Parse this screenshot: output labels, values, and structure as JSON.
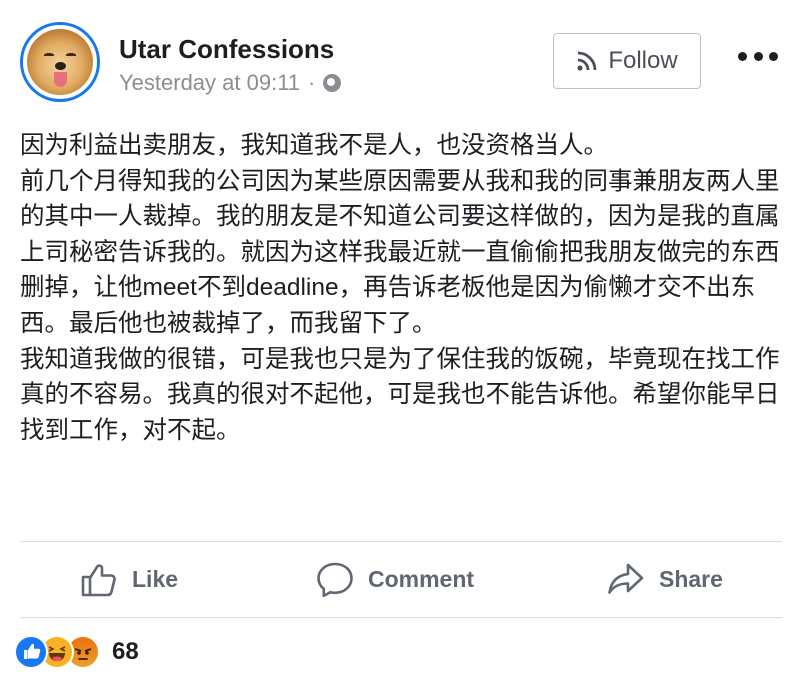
{
  "post": {
    "page_name": "Utar Confessions",
    "timestamp": "Yesterday at 09:11",
    "separator": "·",
    "privacy_icon": "globe-icon",
    "follow_label": "Follow",
    "text": "因为利益出卖朋友，我知道我不是人，也没资格当人。\n前几个月得知我的公司因为某些原因需要从我和我的同事兼朋友两人里的其中一人裁掉。我的朋友是不知道公司要这样做的，因为是我的直属上司秘密告诉我的。就因为这样我最近就一直偷偷把我朋友做完的东西删掉，让他meet不到deadline，再告诉老板他是因为偷懒才交不出东西。最后他也被裁掉了，而我留下了。\n我知道我做的很错，可是我也只是为了保住我的饭碗，毕竟现在找工作真的不容易。我真的很对不起他，可是我也不能告诉他。希望你能早日找到工作，对不起。"
  },
  "actions": {
    "like_label": "Like",
    "comment_label": "Comment",
    "share_label": "Share"
  },
  "reactions": {
    "types": [
      "like",
      "haha",
      "angry"
    ],
    "count": "68"
  },
  "colors": {
    "accent": "#1877f2",
    "text": "#1c1e21",
    "muted": "#8a8d91",
    "action": "#606770"
  }
}
